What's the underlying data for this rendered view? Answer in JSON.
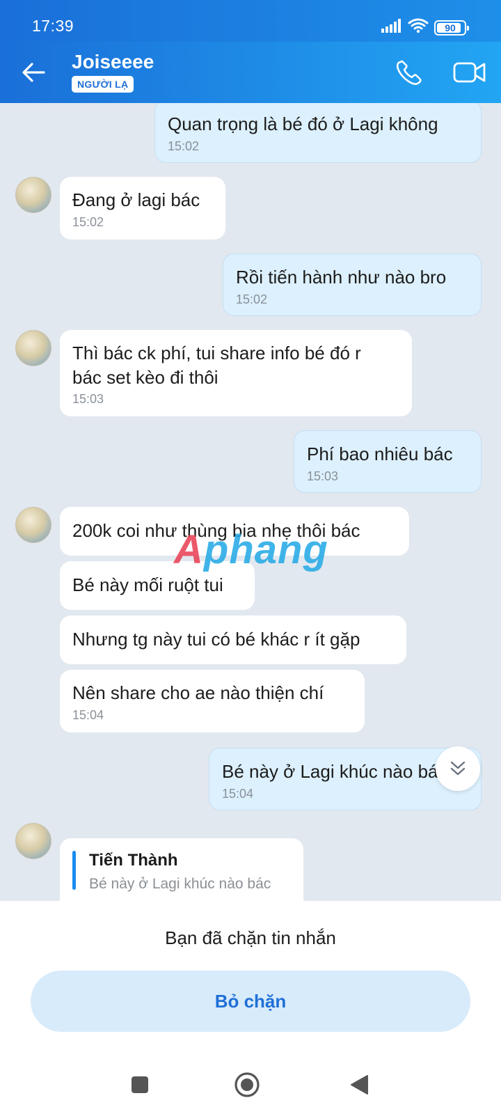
{
  "status_bar": {
    "time": "17:39",
    "battery": "90",
    "battery_level": 0.9
  },
  "header": {
    "contact_name": "Joiseeee",
    "badge": "NGƯỜI LẠ"
  },
  "messages": [
    {
      "from": "me",
      "text": "Quan trọng là bé đó ở Lagi không",
      "time": "15:02"
    },
    {
      "from": "them",
      "text": "Đang ở lagi bác",
      "time": "15:02"
    },
    {
      "from": "me",
      "text": "Rồi tiến hành như nào bro",
      "time": "15:02"
    },
    {
      "from": "them",
      "text_lines": [
        "Thì bác ck phí, tui share info bé đó r",
        "bác set kèo đi thôi"
      ],
      "time": "15:03"
    },
    {
      "from": "me",
      "text": "Phí bao nhiêu bác",
      "time": "15:03"
    },
    {
      "from": "them",
      "text": "200k coi như thùng bia nhẹ thôi bác"
    },
    {
      "from": "them",
      "text": "Bé này mối ruột tui"
    },
    {
      "from": "them",
      "text": "Nhưng tg này tui có bé khác r ít gặp"
    },
    {
      "from": "them",
      "text": "Nên share cho ae nào thiện chí",
      "time": "15:04"
    },
    {
      "from": "me",
      "text": "Bé này ở Lagi khúc nào bác",
      "time": "15:04"
    }
  ],
  "reply": {
    "author": "Tiến Thành",
    "quote": "Bé này ở Lagi khúc nào bác"
  },
  "watermark": {
    "part1": "A",
    "part2": "phang"
  },
  "footer": {
    "blocked_text": "Bạn đã chặn tin nhắn",
    "unblock_label": "Bỏ chặn"
  },
  "icons": {
    "back": "arrow-left-icon",
    "call": "phone-icon",
    "video": "video-camera-icon",
    "scroll": "double-chevron-down-icon",
    "signal": "signal-icon",
    "wifi": "wifi-icon",
    "nav_recent": "square-icon",
    "nav_home": "circle-icon",
    "nav_back": "triangle-back-icon"
  },
  "colors": {
    "header_start": "#1a6fd8",
    "header_end": "#22a5f3",
    "my_bubble": "#dcf0fd",
    "accent": "#1f6fd6"
  }
}
